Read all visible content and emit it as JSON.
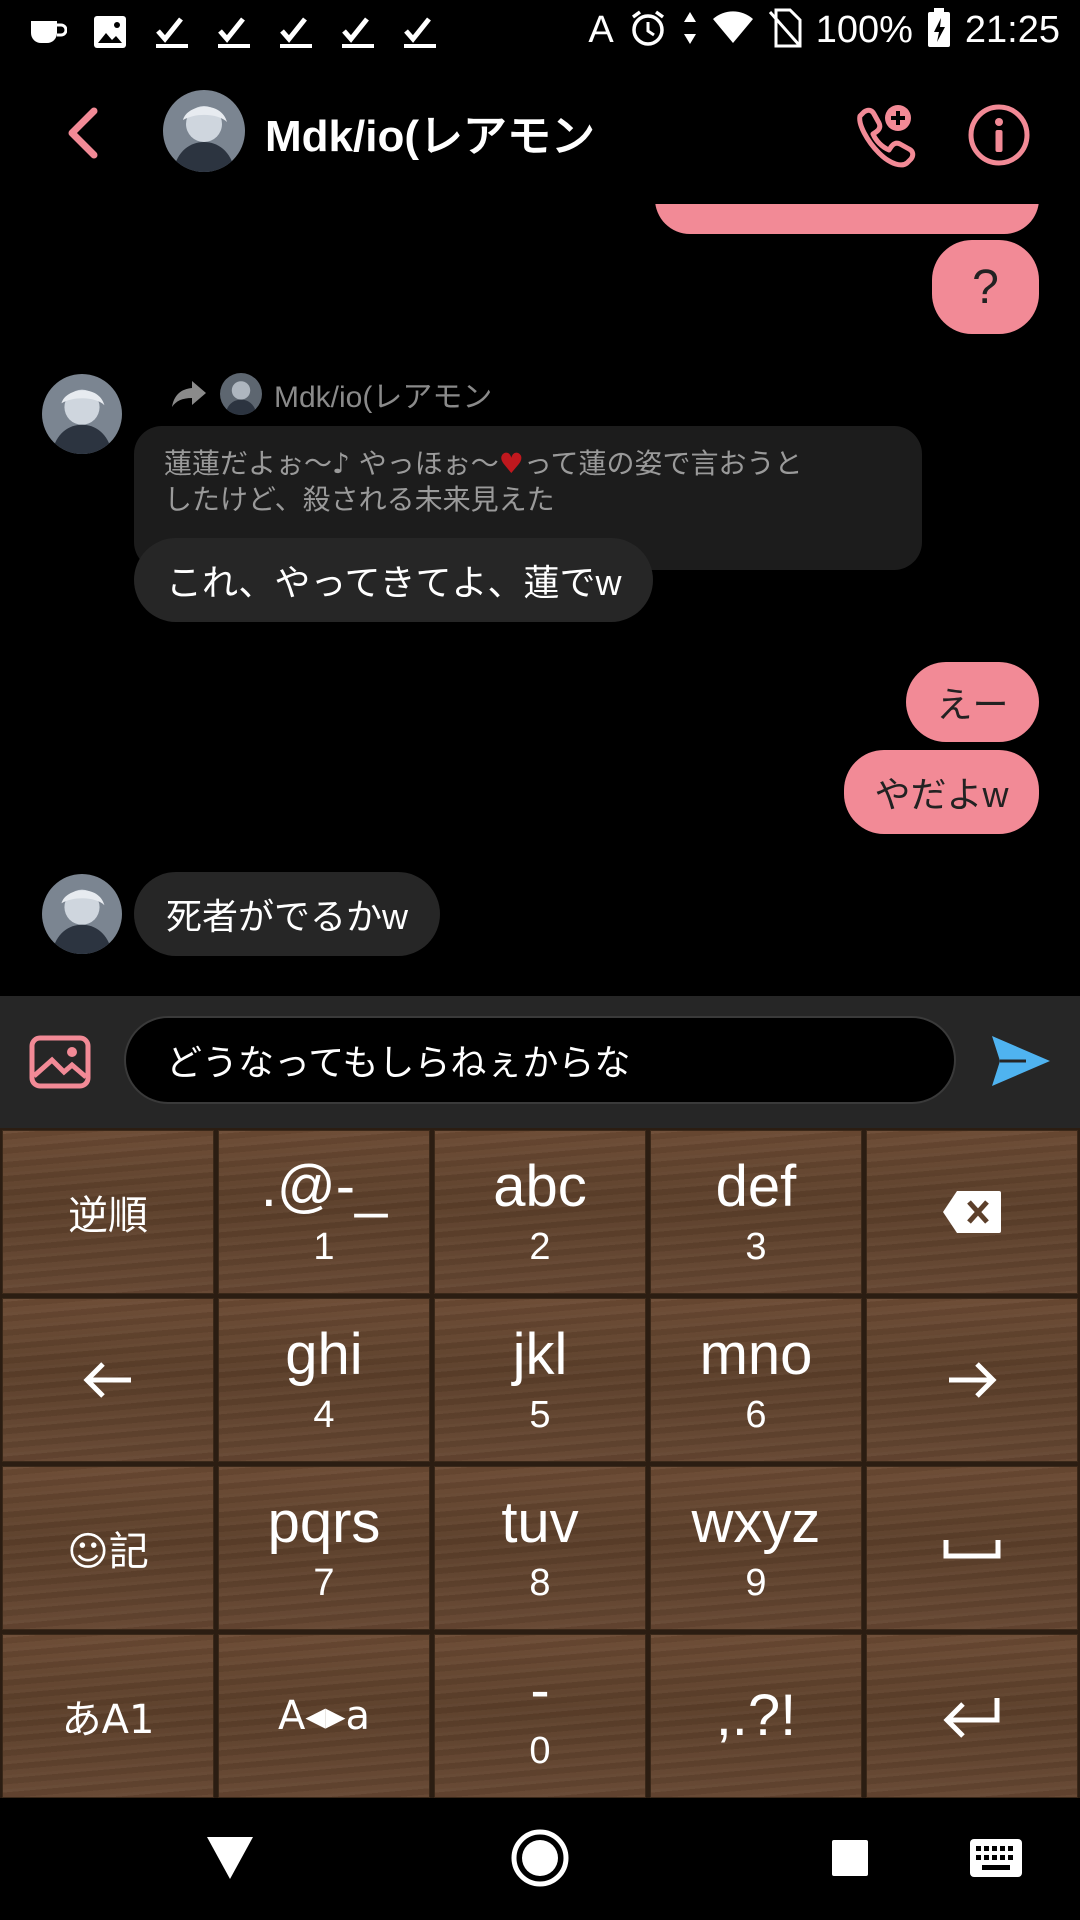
{
  "status_bar": {
    "icons_left": [
      "coffee-icon",
      "image-icon",
      "check-icon",
      "check-icon",
      "check-icon",
      "check-icon",
      "check-icon"
    ],
    "input_mode": "A",
    "battery": "100%",
    "time": "21:25"
  },
  "header": {
    "title": "Mdk/io(レアモン"
  },
  "messages": {
    "partial_top_text": "",
    "out_question": "?",
    "forward_name": "Mdk/io(レアモン",
    "quoted_line1": "蓮蓮だよぉ～♪ やっほぉ～",
    "quoted_heart": "♥",
    "quoted_line1_end": "って蓮の姿で言おうと",
    "quoted_line2": "したけど、殺される未来見えた",
    "in_reply": "これ、やってきてよ、蓮でw",
    "out_1": "えー",
    "out_2": "やだよw",
    "in_2": "死者がでるかw"
  },
  "composer": {
    "value": "どうなってもしらねぇからな"
  },
  "keyboard": {
    "keys": [
      {
        "main": "逆順",
        "sub": ""
      },
      {
        "main": ".@-_",
        "sub": "1"
      },
      {
        "main": "abc",
        "sub": "2"
      },
      {
        "main": "def",
        "sub": "3"
      },
      {
        "main": "⌫",
        "sub": ""
      },
      {
        "main": "←",
        "sub": ""
      },
      {
        "main": "ghi",
        "sub": "4"
      },
      {
        "main": "jkl",
        "sub": "5"
      },
      {
        "main": "mno",
        "sub": "6"
      },
      {
        "main": "→",
        "sub": ""
      },
      {
        "main": "☺記",
        "sub": ""
      },
      {
        "main": "pqrs",
        "sub": "7"
      },
      {
        "main": "tuv",
        "sub": "8"
      },
      {
        "main": "wxyz",
        "sub": "9"
      },
      {
        "main": "␣",
        "sub": ""
      },
      {
        "main": "あA1",
        "sub": ""
      },
      {
        "main": "A◂▸a",
        "sub": ""
      },
      {
        "main": "-",
        "sub": "0"
      },
      {
        "main": ",.?!",
        "sub": ""
      },
      {
        "main": "↵",
        "sub": ""
      }
    ]
  },
  "colors": {
    "accent": "#f28a96",
    "send": "#4fb3f0",
    "incoming_bubble": "#262626"
  }
}
